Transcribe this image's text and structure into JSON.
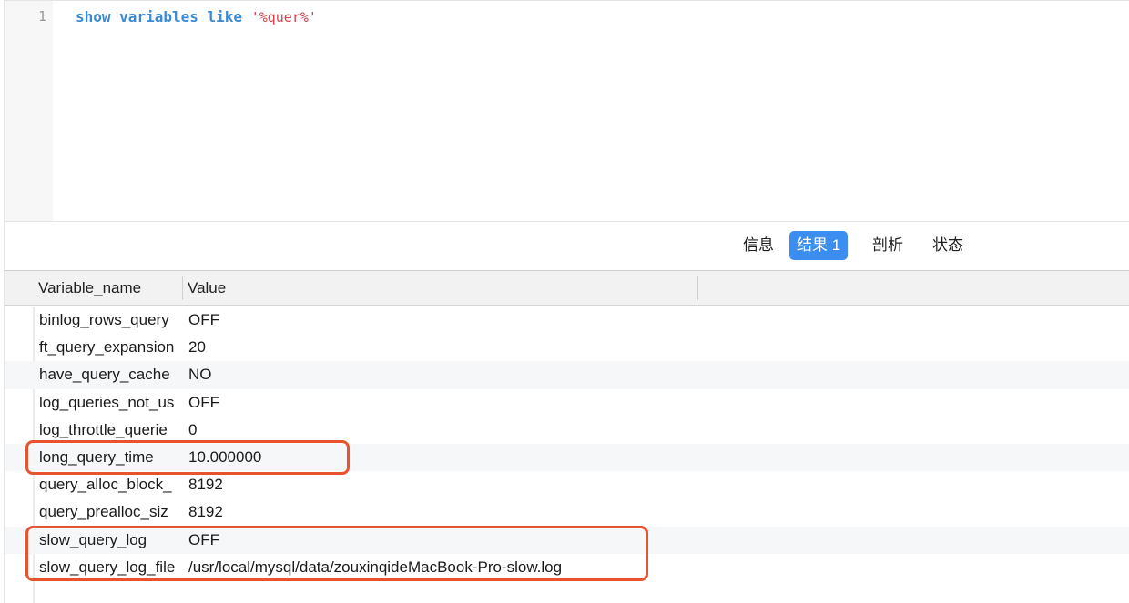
{
  "editor": {
    "line_number": "1",
    "code": {
      "kw1": "show",
      "kw2": "variables",
      "kw3": "like",
      "string": "'%quer%'"
    }
  },
  "tabs": [
    {
      "label": "信息",
      "active": false
    },
    {
      "label": "结果 1",
      "active": true
    },
    {
      "label": "剖析",
      "active": false
    },
    {
      "label": "状态",
      "active": false
    }
  ],
  "grid": {
    "columns": [
      "Variable_name",
      "Value"
    ],
    "rows": [
      {
        "name": "binlog_rows_query",
        "value": "OFF"
      },
      {
        "name": "ft_query_expansion",
        "value": "20"
      },
      {
        "name": "have_query_cache",
        "value": "NO"
      },
      {
        "name": "log_queries_not_us",
        "value": "OFF"
      },
      {
        "name": "log_throttle_querie",
        "value": "0"
      },
      {
        "name": "long_query_time",
        "value": "10.000000"
      },
      {
        "name": "query_alloc_block_",
        "value": "8192"
      },
      {
        "name": "query_prealloc_siz",
        "value": "8192"
      },
      {
        "name": "slow_query_log",
        "value": "OFF"
      },
      {
        "name": "slow_query_log_file",
        "value": "/usr/local/mysql/data/zouxinqideMacBook-Pro-slow.log"
      }
    ]
  },
  "colors": {
    "accent": "#3b8ef0",
    "highlight": "#e8532f",
    "keyword": "#3a8ad6",
    "string": "#d6424b"
  }
}
